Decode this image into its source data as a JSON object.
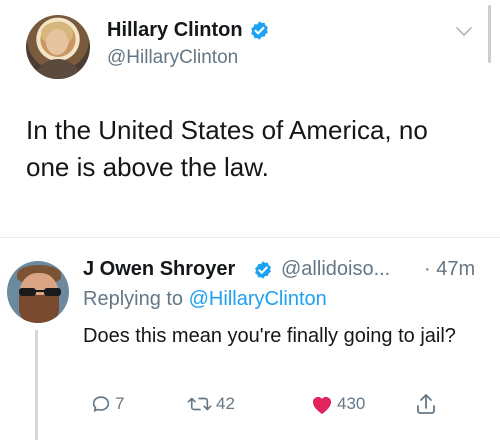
{
  "main_tweet": {
    "author_name": "Hillary Clinton",
    "handle": "@HillaryClinton",
    "text": "In the United States of America, no one is above the law.",
    "verified_icon": "verified-badge-icon",
    "menu_icon": "chevron-down-icon"
  },
  "reply": {
    "author_name": "J Owen Shroyer",
    "handle": "@allidoiso...",
    "time": "· 47m",
    "replying_prefix": "Replying to",
    "replying_mention": "@HillaryClinton",
    "text": "Does this mean you're finally going to jail?",
    "actions": {
      "reply_count": "7",
      "retweet_count": "42",
      "like_count": "430"
    }
  },
  "colors": {
    "accent": "#1da1f2",
    "muted": "#657786",
    "like": "#e0245e",
    "text": "#14171a"
  }
}
